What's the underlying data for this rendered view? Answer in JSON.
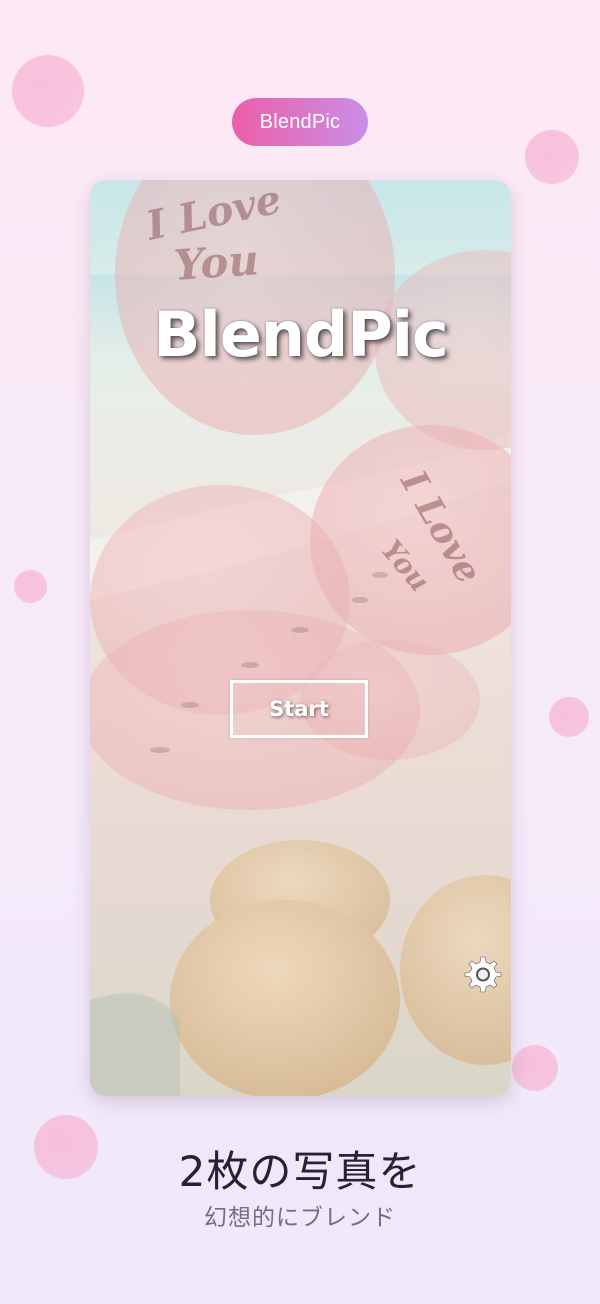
{
  "badge": {
    "label": "BlendPic"
  },
  "app": {
    "title": "BlendPic",
    "start_label": "Start",
    "settings_icon": "gear-icon"
  },
  "caption": {
    "headline": "2枚の写真を",
    "subline": "幻想的にブレンド"
  },
  "colors": {
    "badge_gradient_start": "#ec5fa9",
    "badge_gradient_end": "#c98ee6",
    "background_top": "#fde9f4",
    "background_bottom": "#efe8fb",
    "bubble": "#f5aacd"
  }
}
